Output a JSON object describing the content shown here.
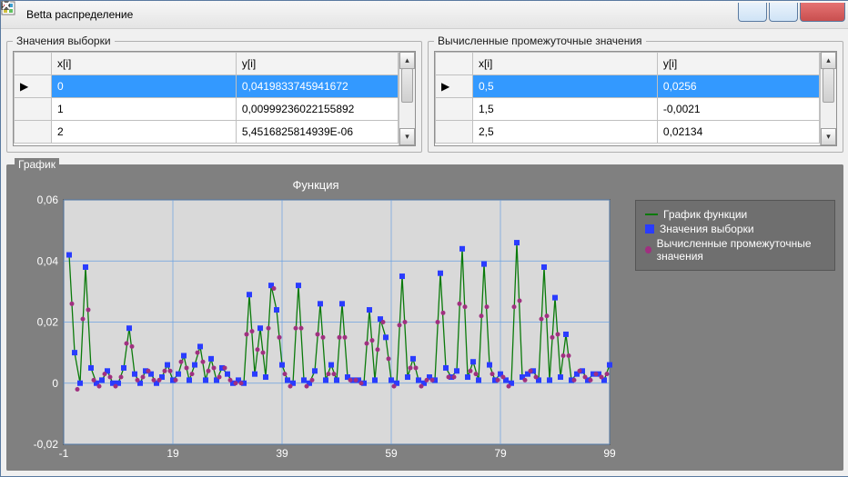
{
  "window": {
    "title": "Betta распределение"
  },
  "panels": {
    "left": {
      "title": "Значения выборки",
      "columns": [
        "x[i]",
        "y[i]"
      ],
      "rows": [
        {
          "x": "0",
          "y": "0,0419833745941672"
        },
        {
          "x": "1",
          "y": "0,00999236022155892"
        },
        {
          "x": "2",
          "y": "5,4516825814939E-06"
        }
      ]
    },
    "right": {
      "title": "Вычисленные промежуточные значения",
      "columns": [
        "x[i]",
        "y[i]"
      ],
      "rows": [
        {
          "x": "0,5",
          "y": "0,0256"
        },
        {
          "x": "1,5",
          "y": "-0,0021"
        },
        {
          "x": "2,5",
          "y": "0,02134"
        }
      ]
    }
  },
  "chart": {
    "panel_title": "График",
    "title": "Функция",
    "xlabel": "",
    "ylabel": "",
    "x_ticks": [
      -1,
      19,
      39,
      59,
      79,
      99
    ],
    "y_ticks": [
      -0.02,
      0,
      0.02,
      0.04,
      0.06
    ],
    "legend": [
      "График функции",
      "Значения выборки",
      "Вычисленные промежуточные значения"
    ]
  },
  "chart_data": {
    "type": "line",
    "xlim": [
      -1,
      99
    ],
    "ylim": [
      -0.02,
      0.06
    ],
    "series": [
      {
        "name": "График функции",
        "kind": "line",
        "color": "#0a7a0a"
      },
      {
        "name": "Значения выборки",
        "kind": "scatter-square",
        "color": "#2a3cff",
        "x": [
          0,
          1,
          2,
          3,
          4,
          5,
          6,
          7,
          8,
          9,
          10,
          11,
          12,
          13,
          14,
          15,
          16,
          17,
          18,
          19,
          20,
          21,
          22,
          23,
          24,
          25,
          26,
          27,
          28,
          29,
          30,
          31,
          32,
          33,
          34,
          35,
          36,
          37,
          38,
          39,
          40,
          41,
          42,
          43,
          44,
          45,
          46,
          47,
          48,
          49,
          50,
          51,
          52,
          53,
          54,
          55,
          56,
          57,
          58,
          59,
          60,
          61,
          62,
          63,
          64,
          65,
          66,
          67,
          68,
          69,
          70,
          71,
          72,
          73,
          74,
          75,
          76,
          77,
          78,
          79,
          80,
          81,
          82,
          83,
          84,
          85,
          86,
          87,
          88,
          89,
          90,
          91,
          92,
          93,
          94,
          95,
          96,
          97,
          98,
          99
        ],
        "y": [
          0.042,
          0.01,
          0.0,
          0.038,
          0.005,
          0.0,
          0.001,
          0.004,
          0.0,
          0.0,
          0.005,
          0.018,
          0.003,
          0.0,
          0.004,
          0.003,
          0.0,
          0.002,
          0.006,
          0.001,
          0.003,
          0.009,
          0.001,
          0.006,
          0.012,
          0.001,
          0.008,
          0.001,
          0.005,
          0.003,
          0.0,
          0.001,
          0.0,
          0.029,
          0.003,
          0.018,
          0.002,
          0.032,
          0.024,
          0.006,
          0.001,
          0.0,
          0.032,
          0.001,
          0.0,
          0.004,
          0.026,
          0.001,
          0.006,
          0.001,
          0.026,
          0.002,
          0.001,
          0.001,
          0.0,
          0.024,
          0.001,
          0.021,
          0.015,
          0.001,
          0.0,
          0.035,
          0.002,
          0.008,
          0.001,
          0.0,
          0.002,
          0.001,
          0.036,
          0.005,
          0.002,
          0.004,
          0.044,
          0.002,
          0.007,
          0.001,
          0.039,
          0.006,
          0.001,
          0.003,
          0.001,
          0.0,
          0.046,
          0.002,
          0.003,
          0.004,
          0.001,
          0.038,
          0.001,
          0.028,
          0.002,
          0.016,
          0.001,
          0.003,
          0.004,
          0.001,
          0.003,
          0.003,
          0.001,
          0.006
        ]
      },
      {
        "name": "Вычисленные промежуточные значения",
        "kind": "scatter-dot",
        "color": "#a03080",
        "x": [
          0.5,
          1.5,
          2.5,
          3.5,
          4.5,
          5.5,
          6.5,
          7.5,
          8.5,
          9.5,
          10.5,
          11.5,
          12.5,
          13.5,
          14.5,
          15.5,
          16.5,
          17.5,
          18.5,
          19.5,
          20.5,
          21.5,
          22.5,
          23.5,
          24.5,
          25.5,
          26.5,
          27.5,
          28.5,
          29.5,
          30.5,
          31.5,
          32.5,
          33.5,
          34.5,
          35.5,
          36.5,
          37.5,
          38.5,
          39.5,
          40.5,
          41.5,
          42.5,
          43.5,
          44.5,
          45.5,
          46.5,
          47.5,
          48.5,
          49.5,
          50.5,
          51.5,
          52.5,
          53.5,
          54.5,
          55.5,
          56.5,
          57.5,
          58.5,
          59.5,
          60.5,
          61.5,
          62.5,
          63.5,
          64.5,
          65.5,
          66.5,
          67.5,
          68.5,
          69.5,
          70.5,
          71.5,
          72.5,
          73.5,
          74.5,
          75.5,
          76.5,
          77.5,
          78.5,
          79.5,
          80.5,
          81.5,
          82.5,
          83.5,
          84.5,
          85.5,
          86.5,
          87.5,
          88.5,
          89.5,
          90.5,
          91.5,
          92.5,
          93.5,
          94.5,
          95.5,
          96.5,
          97.5,
          98.5
        ],
        "y": [
          0.026,
          -0.002,
          0.021,
          0.024,
          0.001,
          -0.001,
          0.003,
          0.002,
          -0.001,
          0.002,
          0.013,
          0.012,
          0.001,
          0.002,
          0.004,
          0.001,
          0.001,
          0.004,
          0.004,
          0.001,
          0.007,
          0.005,
          0.003,
          0.01,
          0.007,
          0.004,
          0.005,
          0.002,
          0.005,
          0.001,
          0.0,
          0.0,
          0.016,
          0.017,
          0.011,
          0.01,
          0.018,
          0.031,
          0.015,
          0.003,
          -0.001,
          0.018,
          0.018,
          -0.001,
          0.001,
          0.016,
          0.015,
          0.003,
          0.003,
          0.015,
          0.015,
          0.001,
          0.001,
          0.0,
          0.013,
          0.014,
          0.011,
          0.02,
          0.008,
          -0.001,
          0.019,
          0.02,
          0.005,
          0.005,
          -0.001,
          0.001,
          0.001,
          0.02,
          0.023,
          0.002,
          0.002,
          0.026,
          0.025,
          0.004,
          0.003,
          0.022,
          0.025,
          0.003,
          0.001,
          0.002,
          -0.001,
          0.025,
          0.027,
          0.001,
          0.004,
          0.002,
          0.021,
          0.022,
          0.015,
          0.016,
          0.009,
          0.009,
          0.001,
          0.004,
          0.002,
          0.001,
          0.003,
          0.002,
          0.003
        ]
      }
    ]
  }
}
